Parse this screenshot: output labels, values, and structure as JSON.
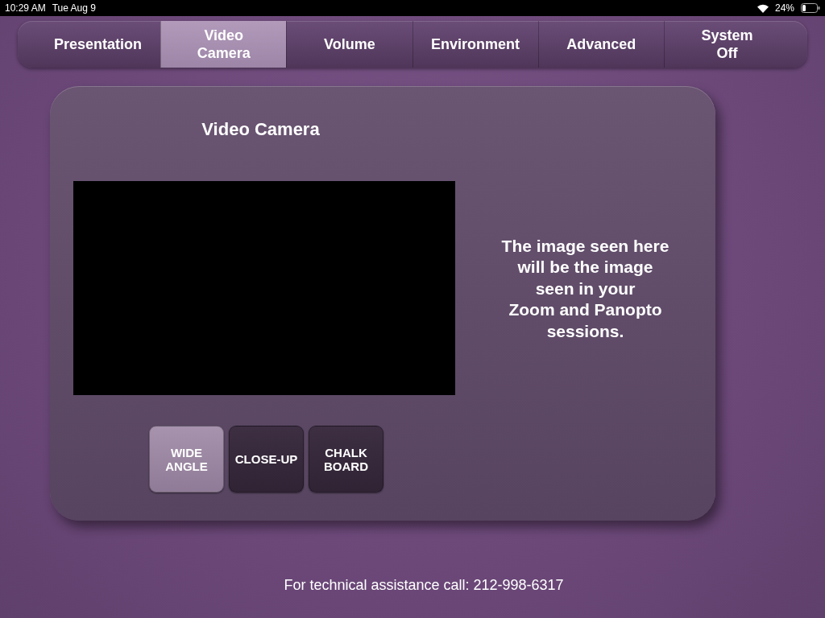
{
  "status_bar": {
    "time": "10:29 AM",
    "date": "Tue Aug 9",
    "battery": "24%"
  },
  "tabs": [
    {
      "label": "Presentation",
      "selected": false
    },
    {
      "label": "Video\nCamera",
      "selected": true
    },
    {
      "label": "Volume",
      "selected": false
    },
    {
      "label": "Environment",
      "selected": false
    },
    {
      "label": "Advanced",
      "selected": false
    },
    {
      "label": "System\nOff",
      "selected": false
    }
  ],
  "panel": {
    "title": "Video Camera",
    "info": "The image seen here\nwill be the image\nseen in your\nZoom and Panopto\nsessions.",
    "presets": [
      {
        "label": "WIDE\nANGLE",
        "selected": true
      },
      {
        "label": "CLOSE-UP",
        "selected": false
      },
      {
        "label": "CHALK\nBOARD",
        "selected": false
      }
    ]
  },
  "footer": "For technical assistance call: 212-998-6317"
}
